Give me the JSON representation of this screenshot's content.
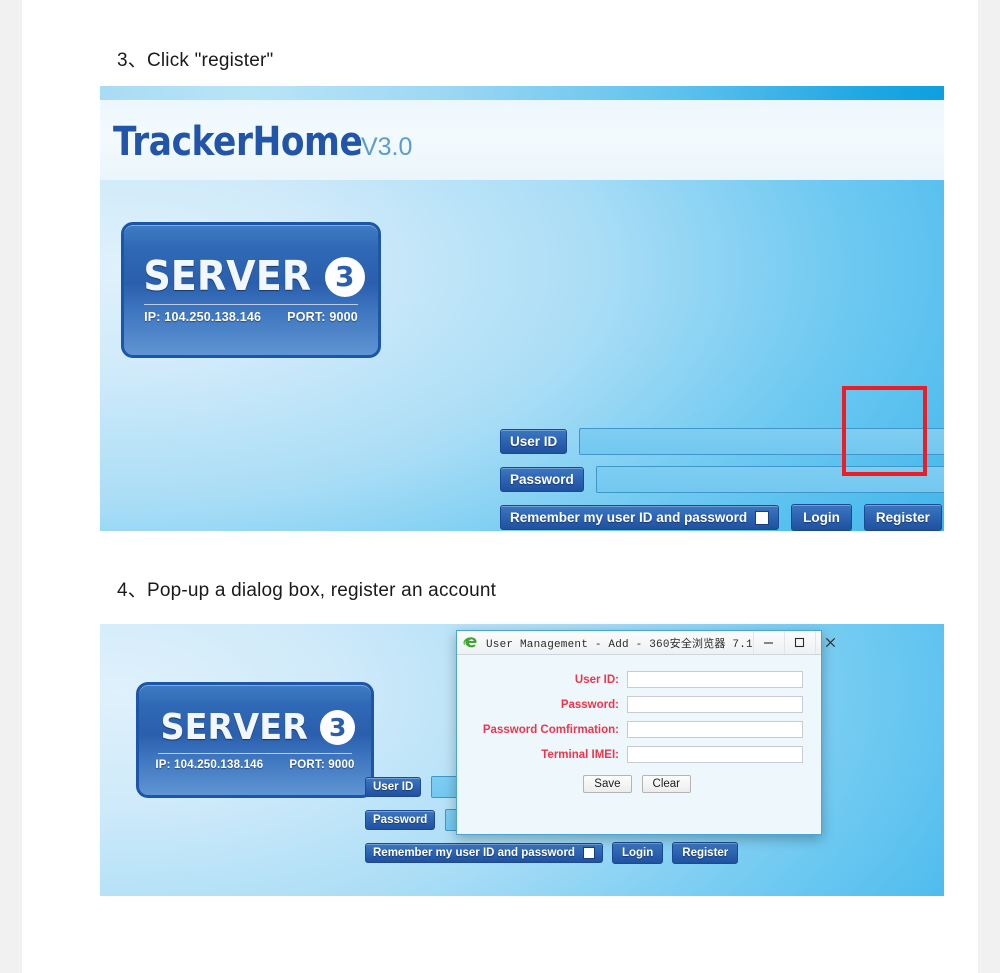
{
  "steps": [
    {
      "id": "step3",
      "text": "3、Click \"register\""
    },
    {
      "id": "step4",
      "text": "4、Pop-up a dialog box, register an account"
    }
  ],
  "app": {
    "brand_name": "TrackerHome",
    "brand_version": "V3.0",
    "server_badge": {
      "title": "SERVER",
      "number": "3",
      "ip_label": "IP: 104.250.138.146",
      "port_label": "PORT: 9000"
    },
    "login_form": {
      "user_id_label": "User ID",
      "user_id_value": "",
      "password_label": "Password",
      "password_value": "",
      "remember_label": "Remember my user ID and password",
      "remember_checked": false,
      "login_button": "Login",
      "register_button": "Register"
    }
  },
  "annotation": {
    "highlight_target": "Register",
    "color": "#ee1c25"
  },
  "dialog": {
    "title": "User Management - Add - 360安全浏览器 7.1",
    "icon": "browser-e-icon",
    "window_controls": {
      "minimize": "minimize-icon",
      "maximize": "maximize-icon",
      "close": "close-icon"
    },
    "fields": [
      {
        "label": "User ID:",
        "value": ""
      },
      {
        "label": "Password:",
        "value": ""
      },
      {
        "label": "Password Comfirmation:",
        "value": ""
      },
      {
        "label": "Terminal IMEI:",
        "value": ""
      }
    ],
    "buttons": {
      "save": "Save",
      "clear": "Clear"
    },
    "label_color": "#f0344b"
  }
}
